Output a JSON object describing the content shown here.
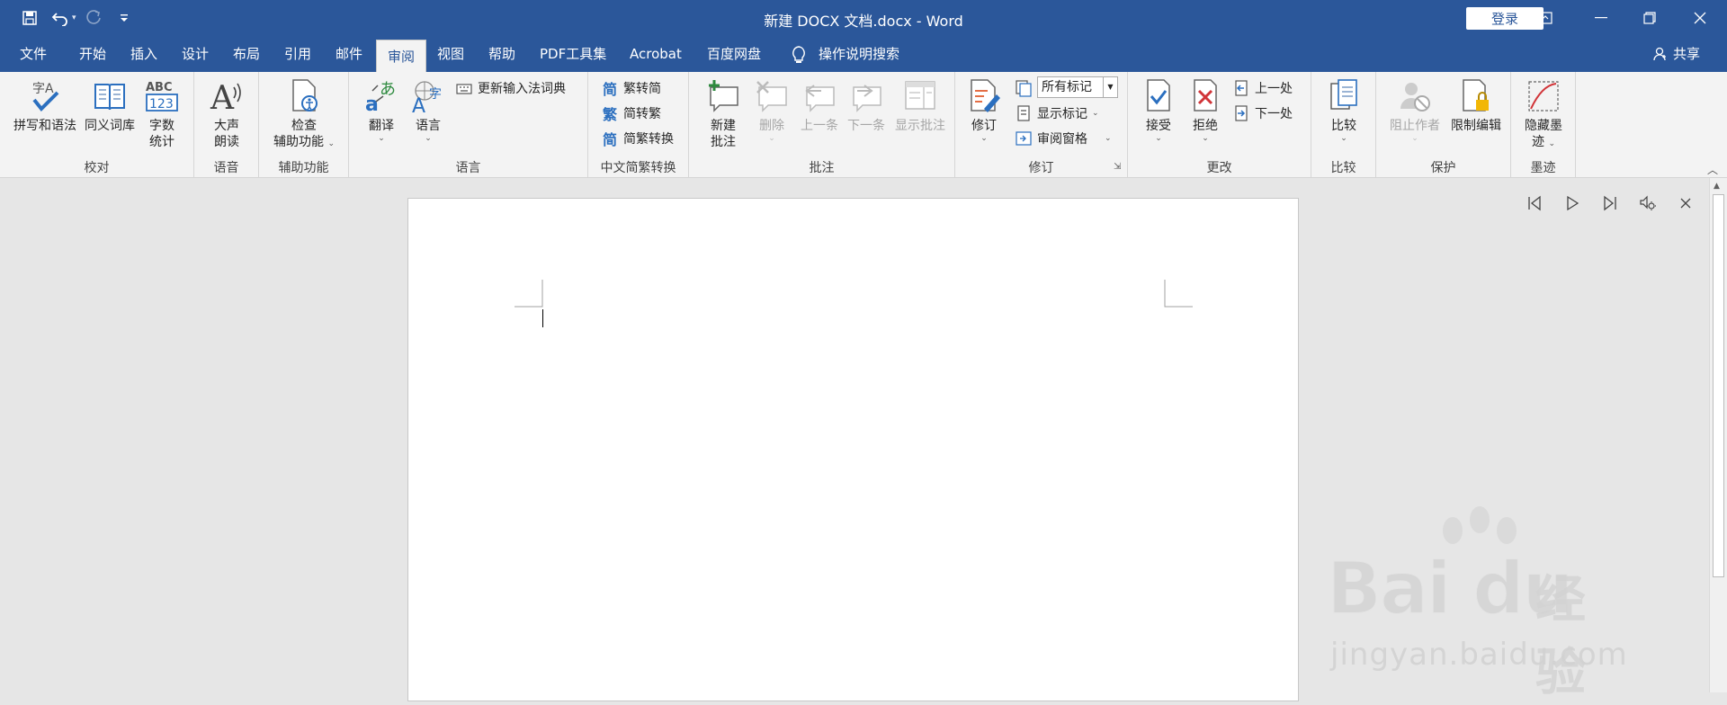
{
  "titlebar": {
    "doc_title": "新建 DOCX 文档.docx  -  Word",
    "login": "登录"
  },
  "tabs": [
    {
      "label": "文件"
    },
    {
      "label": "开始"
    },
    {
      "label": "插入"
    },
    {
      "label": "设计"
    },
    {
      "label": "布局"
    },
    {
      "label": "引用"
    },
    {
      "label": "邮件"
    },
    {
      "label": "审阅"
    },
    {
      "label": "视图"
    },
    {
      "label": "帮助"
    },
    {
      "label": "PDF工具集"
    },
    {
      "label": "Acrobat"
    },
    {
      "label": "百度网盘"
    }
  ],
  "active_tab": "审阅",
  "tell_me": "操作说明搜索",
  "share": "共享",
  "ribbon": {
    "proofing": {
      "label": "校对",
      "spell": "拼写和语法",
      "thesaurus": "同义词库",
      "wordcount_1": "字数",
      "wordcount_2": "统计"
    },
    "speech": {
      "label": "语音",
      "read_1": "大声",
      "read_2": "朗读"
    },
    "accessibility": {
      "label": "辅助功能",
      "check_1": "检查",
      "check_2": "辅助功能"
    },
    "language": {
      "label": "语言",
      "translate": "翻译",
      "language": "语言",
      "update_ime": "更新输入法词典"
    },
    "chinese": {
      "label": "中文简繁转换",
      "t2s": "繁转简",
      "s2t": "简转繁",
      "convert": "简繁转换"
    },
    "comments": {
      "label": "批注",
      "new_1": "新建",
      "new_2": "批注",
      "delete": "删除",
      "prev": "上一条",
      "next": "下一条",
      "show": "显示批注"
    },
    "tracking": {
      "label": "修订",
      "track": "修订",
      "markup_select": "所有标记",
      "show_markup": "显示标记",
      "review_pane": "审阅窗格"
    },
    "changes": {
      "label": "更改",
      "accept": "接受",
      "reject": "拒绝",
      "previous": "上一处",
      "next": "下一处"
    },
    "compare": {
      "label": "比较",
      "compare": "比较"
    },
    "protect": {
      "label": "保护",
      "block": "阻止作者",
      "restrict": "限制编辑"
    },
    "ink": {
      "label": "墨迹",
      "hide_1": "隐藏墨",
      "hide_2": "迹"
    }
  },
  "watermark": {
    "brand": "Bai du",
    "cn": "经验",
    "url": "jingyan.baidu.com"
  },
  "colors": {
    "brand": "#2b579a",
    "ribbon": "#f3f3f3",
    "canvas": "#e6e6e6"
  }
}
